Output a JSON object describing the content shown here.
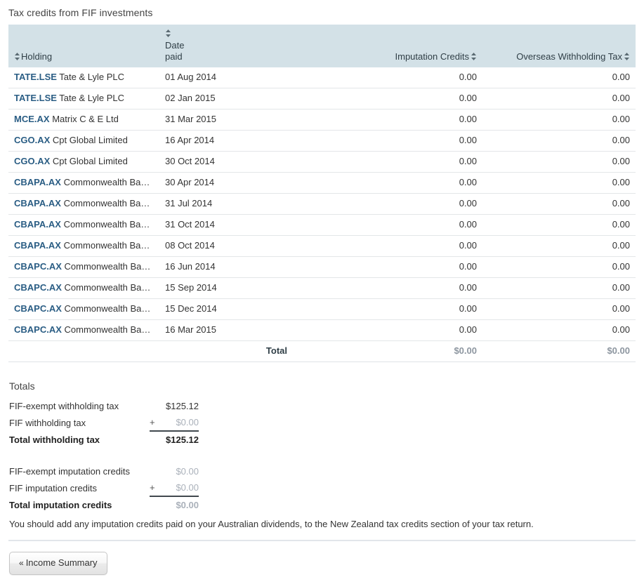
{
  "section": {
    "title": "Tax credits from FIF investments"
  },
  "table": {
    "columns": [
      {
        "key": "holding",
        "label": "Holding",
        "sortable": true,
        "sort_icon": "sort-updown-icon"
      },
      {
        "key": "date_paid",
        "label": "Date paid",
        "label_line1": "Date",
        "label_line2": "paid",
        "sortable": true,
        "sort_icon": "sort-updown-icon"
      },
      {
        "key": "imputation_credits",
        "label": "Imputation Credits",
        "sortable": true,
        "sort_icon": "sort-updown-icon"
      },
      {
        "key": "overseas_withholding_tax",
        "label": "Overseas Withholding Tax",
        "sortable": true,
        "sort_icon": "sort-updown-icon"
      }
    ],
    "rows": [
      {
        "ticker": "TATE.LSE",
        "company": "Tate & Lyle PLC",
        "date_paid": "01 Aug 2014",
        "imputation_credits": "0.00",
        "overseas_withholding_tax": "0.00"
      },
      {
        "ticker": "TATE.LSE",
        "company": "Tate & Lyle PLC",
        "date_paid": "02 Jan 2015",
        "imputation_credits": "0.00",
        "overseas_withholding_tax": "0.00"
      },
      {
        "ticker": "MCE.AX",
        "company": "Matrix C & E Ltd",
        "date_paid": "31 Mar 2015",
        "imputation_credits": "0.00",
        "overseas_withholding_tax": "0.00"
      },
      {
        "ticker": "CGO.AX",
        "company": "Cpt Global Limited",
        "date_paid": "16 Apr 2014",
        "imputation_credits": "0.00",
        "overseas_withholding_tax": "0.00"
      },
      {
        "ticker": "CGO.AX",
        "company": "Cpt Global Limited",
        "date_paid": "30 Oct 2014",
        "imputation_credits": "0.00",
        "overseas_withholding_tax": "0.00"
      },
      {
        "ticker": "CBAPA.AX",
        "company": "Commonwealth Ba…",
        "date_paid": "30 Apr 2014",
        "imputation_credits": "0.00",
        "overseas_withholding_tax": "0.00"
      },
      {
        "ticker": "CBAPA.AX",
        "company": "Commonwealth Ba…",
        "date_paid": "31 Jul 2014",
        "imputation_credits": "0.00",
        "overseas_withholding_tax": "0.00"
      },
      {
        "ticker": "CBAPA.AX",
        "company": "Commonwealth Ba…",
        "date_paid": "31 Oct 2014",
        "imputation_credits": "0.00",
        "overseas_withholding_tax": "0.00"
      },
      {
        "ticker": "CBAPA.AX",
        "company": "Commonwealth Ba…",
        "date_paid": "08 Oct 2014",
        "imputation_credits": "0.00",
        "overseas_withholding_tax": "0.00"
      },
      {
        "ticker": "CBAPC.AX",
        "company": "Commonwealth Ba…",
        "date_paid": "16 Jun 2014",
        "imputation_credits": "0.00",
        "overseas_withholding_tax": "0.00"
      },
      {
        "ticker": "CBAPC.AX",
        "company": "Commonwealth Ba…",
        "date_paid": "15 Sep 2014",
        "imputation_credits": "0.00",
        "overseas_withholding_tax": "0.00"
      },
      {
        "ticker": "CBAPC.AX",
        "company": "Commonwealth Ba…",
        "date_paid": "15 Dec 2014",
        "imputation_credits": "0.00",
        "overseas_withholding_tax": "0.00"
      },
      {
        "ticker": "CBAPC.AX",
        "company": "Commonwealth Ba…",
        "date_paid": "16 Mar 2015",
        "imputation_credits": "0.00",
        "overseas_withholding_tax": "0.00"
      }
    ],
    "footer": {
      "label": "Total",
      "imputation_credits": "$0.00",
      "overseas_withholding_tax": "$0.00"
    }
  },
  "totals": {
    "heading": "Totals",
    "withholding": [
      {
        "label": "FIF-exempt withholding tax",
        "operator": "",
        "value": "$125.12",
        "muted": false,
        "bold": false
      },
      {
        "label": "FIF withholding tax",
        "operator": "+",
        "value": "$0.00",
        "muted": true,
        "bold": false
      },
      {
        "label": "Total withholding tax",
        "operator": "",
        "value": "$125.12",
        "muted": false,
        "bold": true
      }
    ],
    "imputation": [
      {
        "label": "FIF-exempt imputation credits",
        "operator": "",
        "value": "$0.00",
        "muted": true,
        "bold": false
      },
      {
        "label": "FIF imputation credits",
        "operator": "+",
        "value": "$0.00",
        "muted": true,
        "bold": false
      },
      {
        "label": "Total imputation credits",
        "operator": "",
        "value": "$0.00",
        "muted": true,
        "bold": true
      }
    ]
  },
  "note": "You should add any imputation credits paid on your Australian dividends, to the New Zealand tax credits section of your tax return.",
  "footer_nav": {
    "back_chevron": "«",
    "back_label": "Income Summary"
  },
  "colors": {
    "header_bg": "#d3e1e7",
    "link": "#2a5d84",
    "muted_value": "#9aa3ad",
    "row_border": "#e3e6e8",
    "rule": "#e2e6ea"
  }
}
